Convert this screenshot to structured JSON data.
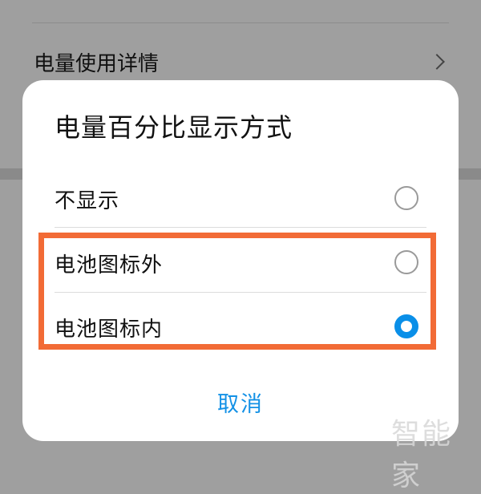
{
  "background": {
    "row_label": "电量使用详情",
    "chevron_icon": "chevron-right-icon"
  },
  "dialog": {
    "title": "电量百分比显示方式",
    "options": [
      {
        "label": "不显示",
        "selected": false
      },
      {
        "label": "电池图标外",
        "selected": false
      },
      {
        "label": "电池图标内",
        "selected": true
      }
    ],
    "cancel_label": "取消"
  },
  "colors": {
    "accent": "#0a8fe8",
    "highlight_border": "#f26b36",
    "cancel_text": "#1391e6",
    "overlay": "#9f9f9f"
  },
  "watermark": "智能家"
}
